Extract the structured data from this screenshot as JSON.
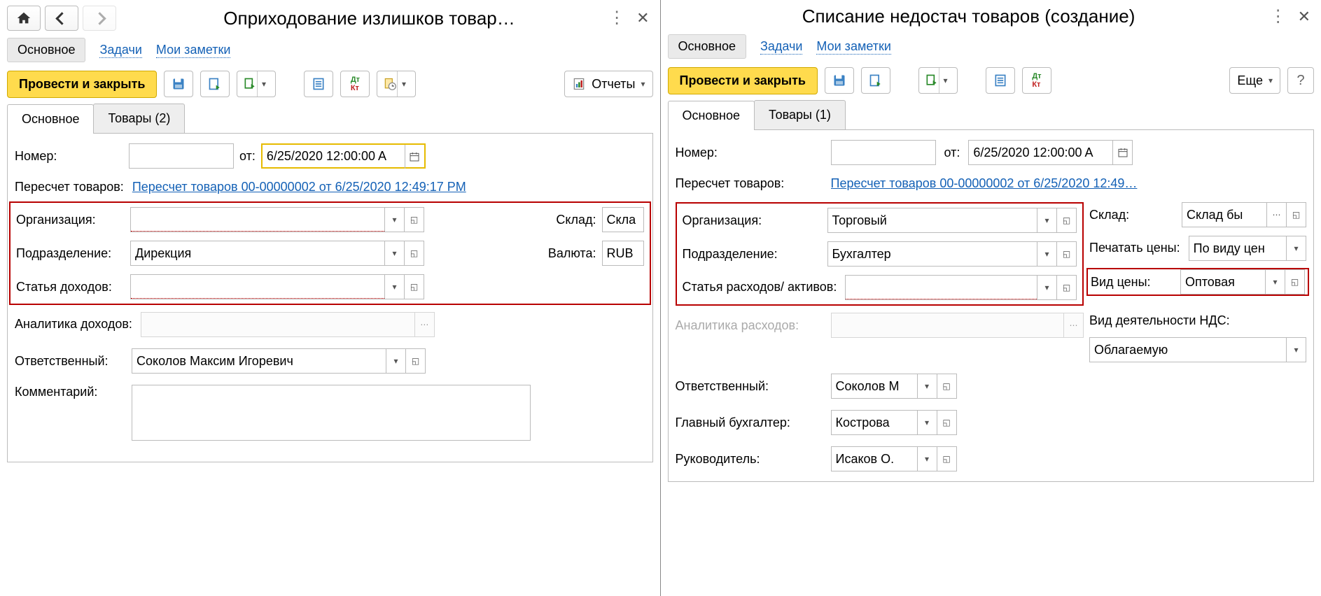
{
  "left": {
    "title": "Оприходование излишков товар…",
    "switch": {
      "main": "Основное",
      "tasks": "Задачи",
      "notes": "Мои заметки"
    },
    "toolbar": {
      "post_close": "Провести и закрыть",
      "reports": "Отчеты"
    },
    "tabs": {
      "main": "Основное",
      "goods": "Товары (2)"
    },
    "form": {
      "number_label": "Номер:",
      "number_value": "",
      "from_label": "от:",
      "date_value": "6/25/2020 12:00:00 A",
      "recount_label": "Пересчет товаров:",
      "recount_link": "Пересчет товаров 00-00000002 от 6/25/2020 12:49:17 PM",
      "org_label": "Организация:",
      "org_value": "",
      "dept_label": "Подразделение:",
      "dept_value": "Дирекция",
      "income_label": "Статья доходов:",
      "income_value": "",
      "warehouse_label": "Склад:",
      "warehouse_value": "Скла",
      "currency_label": "Валюта:",
      "currency_value": "RUB",
      "analytics_label": "Аналитика доходов:",
      "responsible_label": "Ответственный:",
      "responsible_value": "Соколов Максим Игоревич",
      "comment_label": "Комментарий:"
    }
  },
  "right": {
    "title": "Списание недостач товаров (создание)",
    "switch": {
      "main": "Основное",
      "tasks": "Задачи",
      "notes": "Мои заметки"
    },
    "toolbar": {
      "post_close": "Провести и закрыть",
      "more": "Еще",
      "help": "?"
    },
    "tabs": {
      "main": "Основное",
      "goods": "Товары (1)"
    },
    "form": {
      "number_label": "Номер:",
      "number_value": "",
      "from_label": "от:",
      "date_value": "6/25/2020 12:00:00 A",
      "recount_label": "Пересчет товаров:",
      "recount_link": "Пересчет товаров 00-00000002 от 6/25/2020 12:49…",
      "org_label": "Организация:",
      "org_value": "Торговый",
      "dept_label": "Подразделение:",
      "dept_value": "Бухгалтер",
      "expense_label": "Статья расходов/ активов:",
      "expense_value": "",
      "warehouse_label": "Склад:",
      "warehouse_value": "Склад бы",
      "print_prices_label": "Печатать цены:",
      "print_prices_value": "По виду цен",
      "price_type_label": "Вид цены:",
      "price_type_value": "Оптовая",
      "analytics_label": "Аналитика расходов:",
      "vat_mode_label": "Вид деятельности НДС:",
      "vat_mode_value": "Облагаемую",
      "responsible_label": "Ответственный:",
      "responsible_value": "Соколов М",
      "accountant_label": "Главный бухгалтер:",
      "accountant_value": "Кострова",
      "director_label": "Руководитель:",
      "director_value": "Исаков О."
    }
  }
}
